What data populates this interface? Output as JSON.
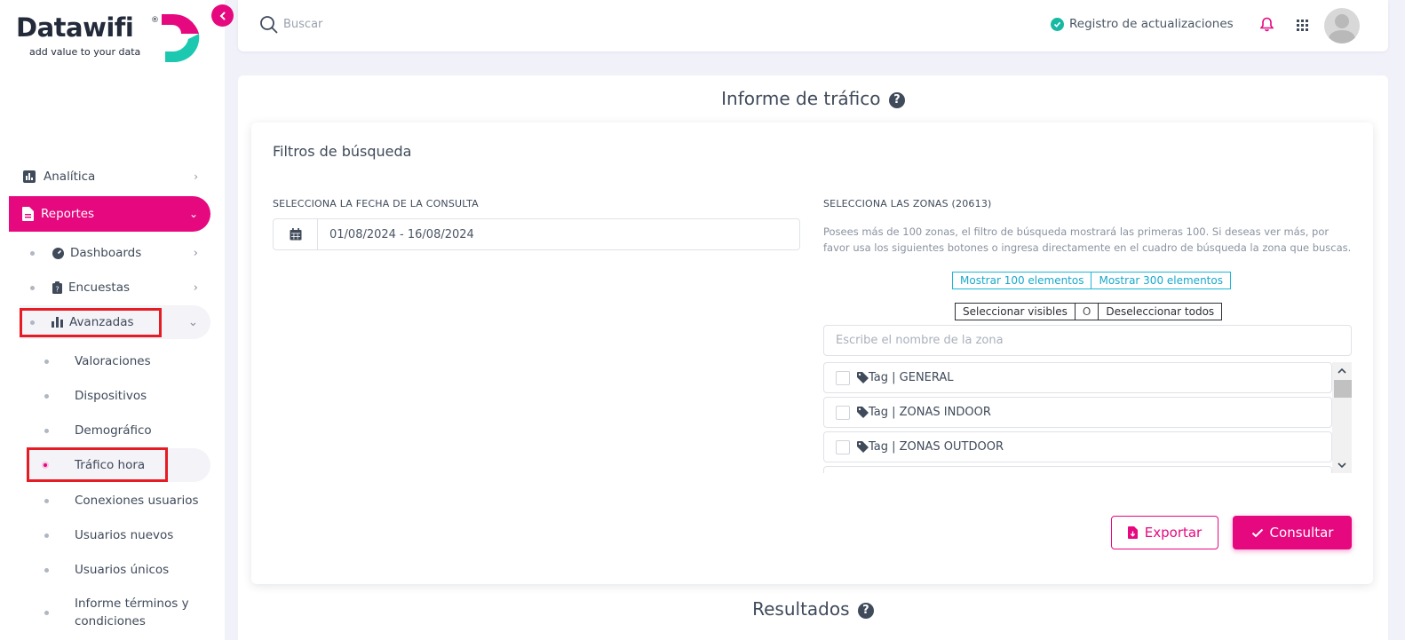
{
  "brand": {
    "name": "Datawifi",
    "registered": "®",
    "tagline": "add value to your data",
    "accent_color": "#e6087f",
    "teal_color": "#1cc9b0"
  },
  "sidebar": {
    "items": [
      {
        "label": "Analítica",
        "icon": "chart-icon",
        "expanded": false
      },
      {
        "label": "Reportes",
        "icon": "document-icon",
        "expanded": true,
        "active": true
      }
    ],
    "reportes_children": [
      {
        "label": "Dashboards",
        "icon": "dashboard-icon"
      },
      {
        "label": "Encuestas",
        "icon": "clipboard-icon"
      },
      {
        "label": "Avanzadas",
        "icon": "bar-chart-icon",
        "expanded": true,
        "highlighted": true
      }
    ],
    "avanzadas_children": [
      {
        "label": "Valoraciones"
      },
      {
        "label": "Dispositivos"
      },
      {
        "label": "Demográfico"
      },
      {
        "label": "Tráfico hora",
        "active": true,
        "highlighted": true
      },
      {
        "label": "Conexiones usuarios"
      },
      {
        "label": "Usuarios nuevos"
      },
      {
        "label": "Usuarios únicos"
      },
      {
        "label": "Informe términos y condiciones"
      }
    ]
  },
  "header": {
    "search_placeholder": "Buscar",
    "updates_label": "Registro de actualizaciones"
  },
  "main": {
    "title": "Informe de tráfico",
    "filters": {
      "title": "Filtros de búsqueda",
      "date_label": "SELECCIONA LA FECHA DE LA CONSULTA",
      "date_value": "01/08/2024 - 16/08/2024",
      "zones_label": "SELECCIONA LAS ZONAS (20613)",
      "zones_note": "Posees más de 100 zonas, el filtro de búsqueda mostrará las primeras 100. Si deseas ver más, por favor usa los siguientes botones o ingresa directamente en el cuadro de búsqueda la zona que buscas.",
      "show_100": "Mostrar 100 elementos",
      "show_300": "Mostrar 300 elementos",
      "select_visible": "Seleccionar visibles",
      "or": "O",
      "deselect_all": "Deseleccionar todos",
      "zone_search_placeholder": "Escribe el nombre de la zona",
      "zones": [
        {
          "label": "Tag | GENERAL",
          "checked": false
        },
        {
          "label": "Tag | ZONAS INDOOR",
          "checked": false
        },
        {
          "label": "Tag | ZONAS OUTDOOR",
          "checked": false
        }
      ],
      "export_label": "Exportar",
      "consult_label": "Consultar"
    },
    "results_title": "Resultados"
  }
}
